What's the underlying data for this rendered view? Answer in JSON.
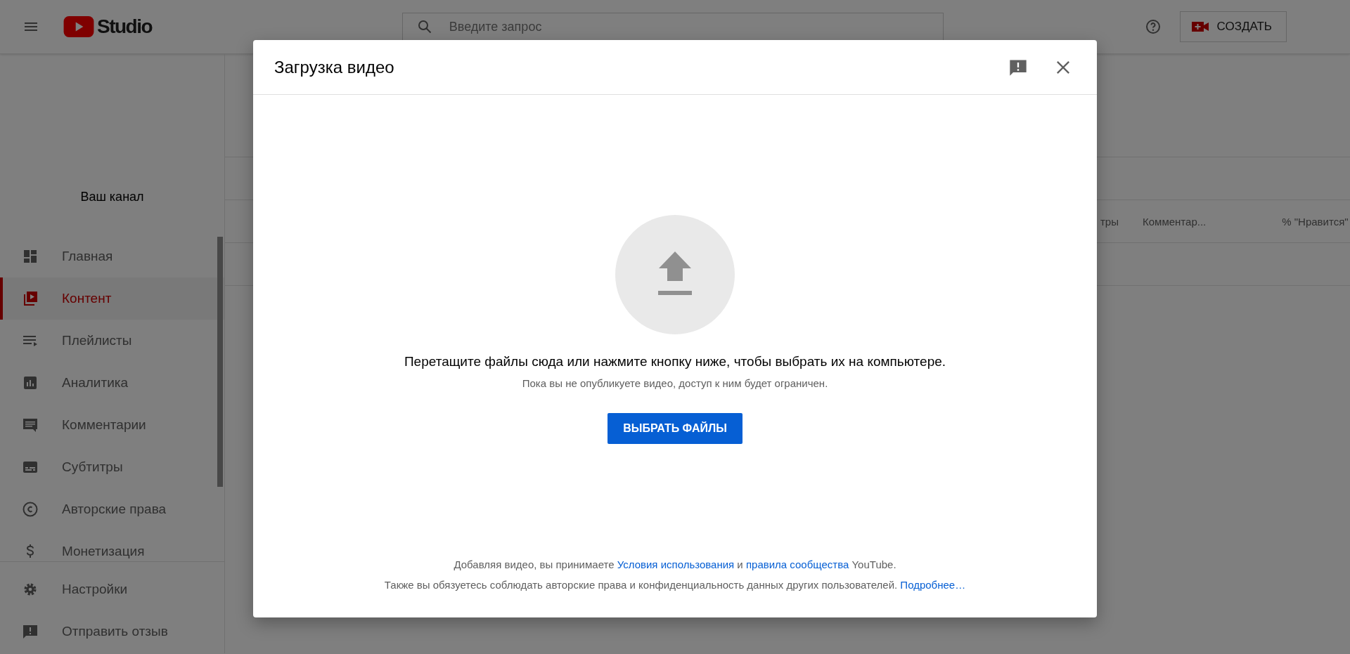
{
  "header": {
    "logo_text": "Studio",
    "search": {
      "placeholder": "Введите запрос"
    },
    "create_button": "СОЗДАТЬ"
  },
  "sidebar": {
    "channel_label": "Ваш канал",
    "items": [
      {
        "label": "Главная",
        "selected": false
      },
      {
        "label": "Контент",
        "selected": true
      },
      {
        "label": "Плейлисты",
        "selected": false
      },
      {
        "label": "Аналитика",
        "selected": false
      },
      {
        "label": "Комментарии",
        "selected": false
      },
      {
        "label": "Субтитры",
        "selected": false
      },
      {
        "label": "Авторские права",
        "selected": false
      },
      {
        "label": "Монетизация",
        "selected": false
      }
    ],
    "bottom_items": [
      {
        "label": "Настройки"
      },
      {
        "label": "Отправить отзыв"
      }
    ]
  },
  "table": {
    "columns": [
      "тры",
      "Комментар...",
      "% \"Нравится\""
    ]
  },
  "dialog": {
    "title": "Загрузка видео",
    "prompt": "Перетащите файлы сюда или нажмите кнопку ниже, чтобы выбрать их на компьютере.",
    "note": "Пока вы не опубликуете видео, доступ к ним будет ограничен.",
    "button": "ВЫБРАТЬ ФАЙЛЫ",
    "footer": [
      [
        {
          "text": "Добавляя видео, вы принимаете ",
          "link": false
        },
        {
          "text": "Условия использования",
          "link": true
        },
        {
          "text": " и ",
          "link": false
        },
        {
          "text": "правила сообщества",
          "link": true
        },
        {
          "text": " YouTube.",
          "link": false
        }
      ],
      [
        {
          "text": "Также вы обязуетесь соблюдать авторские права и конфиденциальность данных других пользователей. ",
          "link": false
        },
        {
          "text": "Подробнее…",
          "link": true
        }
      ]
    ]
  }
}
